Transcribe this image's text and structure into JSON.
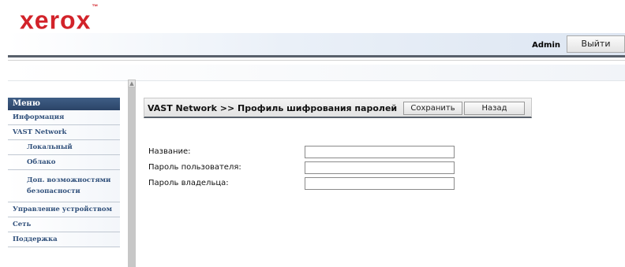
{
  "brand": {
    "logo_text": "xerox",
    "trademark": "™"
  },
  "header": {
    "user": "Admin",
    "logout_label": "Выйти"
  },
  "sidebar": {
    "title": "Меню",
    "items": [
      {
        "label": "Информация"
      },
      {
        "label": "VAST Network"
      },
      {
        "label": "Локальный"
      },
      {
        "label": "Облако"
      },
      {
        "label": "Доп. возможностями безопасности"
      },
      {
        "label": "Управление устройством"
      },
      {
        "label": "Сеть"
      },
      {
        "label": "Поддержка"
      }
    ]
  },
  "panel": {
    "title": "VAST Network >> Профиль шифрования паролей",
    "save_label": "Сохранить",
    "back_label": "Назад"
  },
  "form": {
    "fields": [
      {
        "label": "Название:",
        "value": ""
      },
      {
        "label": "Пароль пользователя:",
        "value": ""
      },
      {
        "label": "Пароль владельца:",
        "value": ""
      }
    ]
  }
}
